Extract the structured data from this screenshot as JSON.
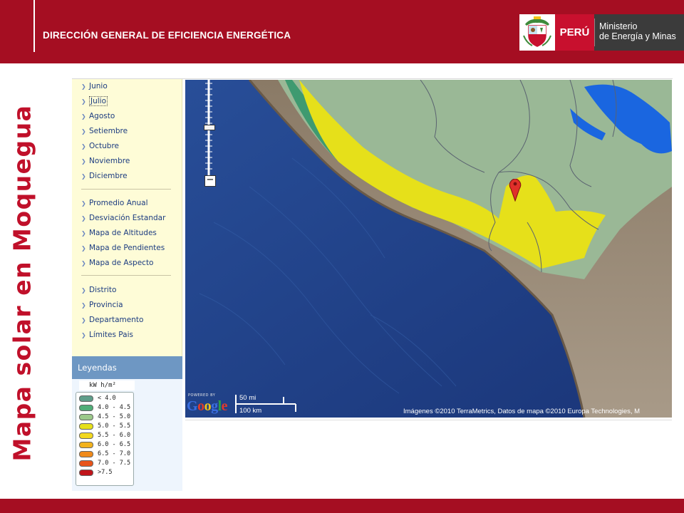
{
  "header": {
    "title": "DIRECCIÓN GENERAL DE EFICIENCIA ENERGÉTICA",
    "logo_country": "PERÚ",
    "logo_ministry_line1": "Ministerio",
    "logo_ministry_line2": "de Energía y Minas"
  },
  "side_title": "Mapa solar en Moquegua",
  "menu": {
    "months": [
      {
        "label": "Junio",
        "selected": false
      },
      {
        "label": "Julio",
        "selected": true
      },
      {
        "label": "Agosto",
        "selected": false
      },
      {
        "label": "Setiembre",
        "selected": false
      },
      {
        "label": "Octubre",
        "selected": false
      },
      {
        "label": "Noviembre",
        "selected": false
      },
      {
        "label": "Diciembre",
        "selected": false
      }
    ],
    "maps": [
      {
        "label": "Promedio Anual"
      },
      {
        "label": "Desviación Estandar"
      },
      {
        "label": "Mapa de Altitudes"
      },
      {
        "label": "Mapa de Pendientes"
      },
      {
        "label": "Mapa de Aspecto"
      }
    ],
    "boundaries": [
      {
        "label": "Distrito"
      },
      {
        "label": "Provincia"
      },
      {
        "label": "Departamento"
      },
      {
        "label": "Límites Pais"
      }
    ]
  },
  "legend": {
    "header": "Leyendas",
    "unit_title": "kW h/m²",
    "items": [
      {
        "label": "< 4.0",
        "color": "#5f9e8a"
      },
      {
        "label": "4.0 - 4.5",
        "color": "#4fae78"
      },
      {
        "label": "4.5 - 5.0",
        "color": "#9cc98a"
      },
      {
        "label": "5.0 - 5.5",
        "color": "#e6e01a"
      },
      {
        "label": "5.5 - 6.0",
        "color": "#f2d81e"
      },
      {
        "label": "6.0 - 6.5",
        "color": "#f2b21c"
      },
      {
        "label": "6.5 - 7.0",
        "color": "#f08a1a"
      },
      {
        "label": "7.0 - 7.5",
        "color": "#e8541a"
      },
      {
        "label": ">7.5",
        "color": "#c0141a"
      }
    ]
  },
  "map": {
    "powered_by": "POWERED BY",
    "google": "Google",
    "scale_miles": "50 mi",
    "scale_km": "100 km",
    "copyright": "Imágenes ©2010 TerraMetrics, Datos de mapa ©2010 Europa Technologies, M",
    "icons": {
      "zoom": "zoom-slider-icon",
      "marker": "map-marker-icon"
    }
  },
  "colors": {
    "brand_red": "#a50e22",
    "menu_bg": "#fefcd7",
    "legend_header": "#6e97c3",
    "ocean": "#1f3f86"
  }
}
